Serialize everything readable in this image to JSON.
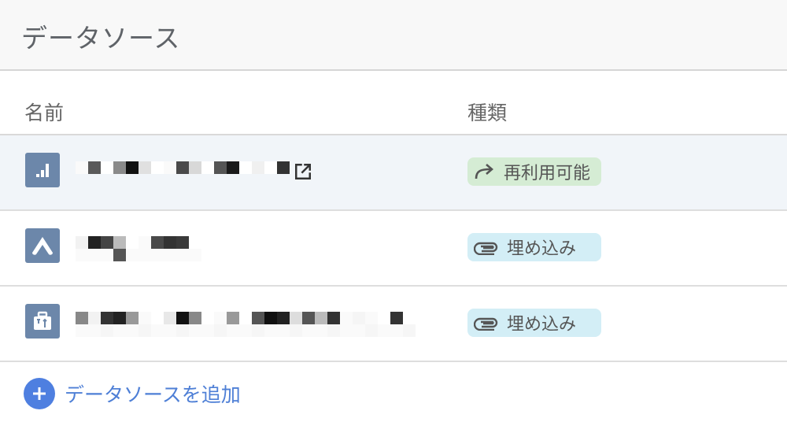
{
  "header": {
    "title": "データソース"
  },
  "columns": {
    "name": "名前",
    "type": "種類"
  },
  "rows": [
    {
      "icon": "bar-chart-icon",
      "type_label": "再利用可能",
      "type_icon": "share-arrow-icon",
      "selected": true
    },
    {
      "icon": "app-logo-icon",
      "type_label": "埋め込み",
      "type_icon": "paperclip-icon",
      "selected": false
    },
    {
      "icon": "toolbox-icon",
      "type_label": "埋め込み",
      "type_icon": "paperclip-icon",
      "selected": false
    }
  ],
  "add_source": {
    "label": "データソースを追加"
  },
  "colors": {
    "accent": "#4e7fe0",
    "icon_bg": "#6c87aa",
    "reuse_badge": "#d5ecd4",
    "embed_badge": "#d3eef6",
    "selected_row": "#f1f5f9"
  }
}
